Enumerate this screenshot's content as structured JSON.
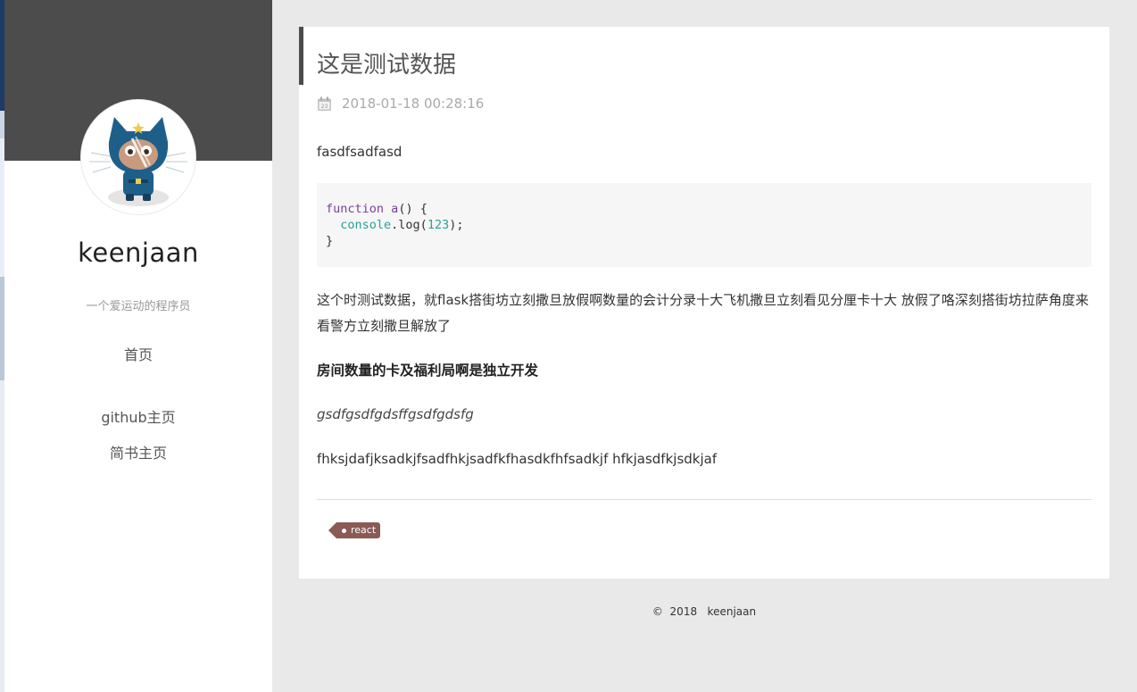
{
  "sidebar": {
    "site_name": "keenjaan",
    "site_description": "一个爱运动的程序员",
    "avatar_icon": "octocat-avatar-icon",
    "header_color": "#4c4c4c",
    "nav": [
      {
        "label": "首页"
      },
      {
        "label": "github主页"
      },
      {
        "label": "简书主页"
      }
    ]
  },
  "post": {
    "title": "这是测试数据",
    "date": "2018-01-18 00:28:16",
    "date_icon": "calendar-icon",
    "paragraph1": "fasdfsadfasd",
    "code": {
      "line1_keyword": "function",
      "line1_name": "a",
      "line1_rest": "() {",
      "line2_indent": "  ",
      "line2_object": "console",
      "line2_method": ".log(",
      "line2_number": "123",
      "line2_end": ");",
      "line3": "}"
    },
    "paragraph2": "这个时测试数据，就flask搭街坊立刻撒旦放假啊数量的会计分录十大飞机撒旦立刻看见分厘卡十大 放假了咯深刻搭街坊拉萨角度来看警方立刻撒旦解放了",
    "bold_heading": "房间数量的卡及福利局啊是独立开发",
    "italic_text": "gsdfgsdfgdsffgsdfgdsfg",
    "paragraph3": "fhksjdafjksadkjfsadfhkjsadfkfhasdkfhfsadkjf hfkjasdfkjsdkjaf",
    "tag": {
      "label": "react",
      "color": "#8b5a55"
    }
  },
  "footer": {
    "copyright_symbol": "©",
    "year": "2018",
    "author": "keenjaan"
  }
}
